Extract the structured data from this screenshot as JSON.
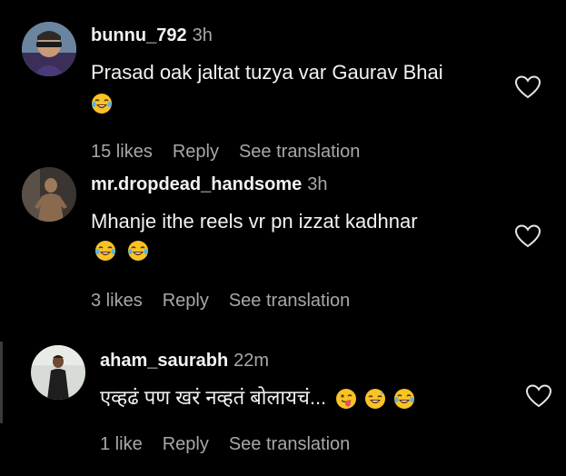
{
  "comments": [
    {
      "username": "bunnu_792",
      "time": "3h",
      "text": "Prasad oak jaltat tuzya var Gaurav Bhai",
      "emojis": [
        "laughing-crying-emoji"
      ],
      "likes": "15 likes",
      "reply": "Reply",
      "translation": "See translation"
    },
    {
      "username": "mr.dropdead_handsome",
      "time": "3h",
      "text": "Mhanje ithe reels vr pn izzat kadhnar",
      "emojis": [
        "laughing-crying-emoji",
        "laughing-crying-emoji"
      ],
      "likes": "3 likes",
      "reply": "Reply",
      "translation": "See translation"
    },
    {
      "username": "aham_saurabh",
      "time": "22m",
      "text": "एव्हढं पण खरं नव्हतं बोलायचं...",
      "emojis": [
        "winking-tongue-emoji",
        "sweat-smile-emoji",
        "laughing-crying-emoji"
      ],
      "likes": "1 like",
      "reply": "Reply",
      "translation": "See translation"
    }
  ],
  "colors": {
    "background": "#000000",
    "text": "#f2f2f2",
    "secondary": "#a8a8a8",
    "emoji_yellow": "#f7c325"
  }
}
